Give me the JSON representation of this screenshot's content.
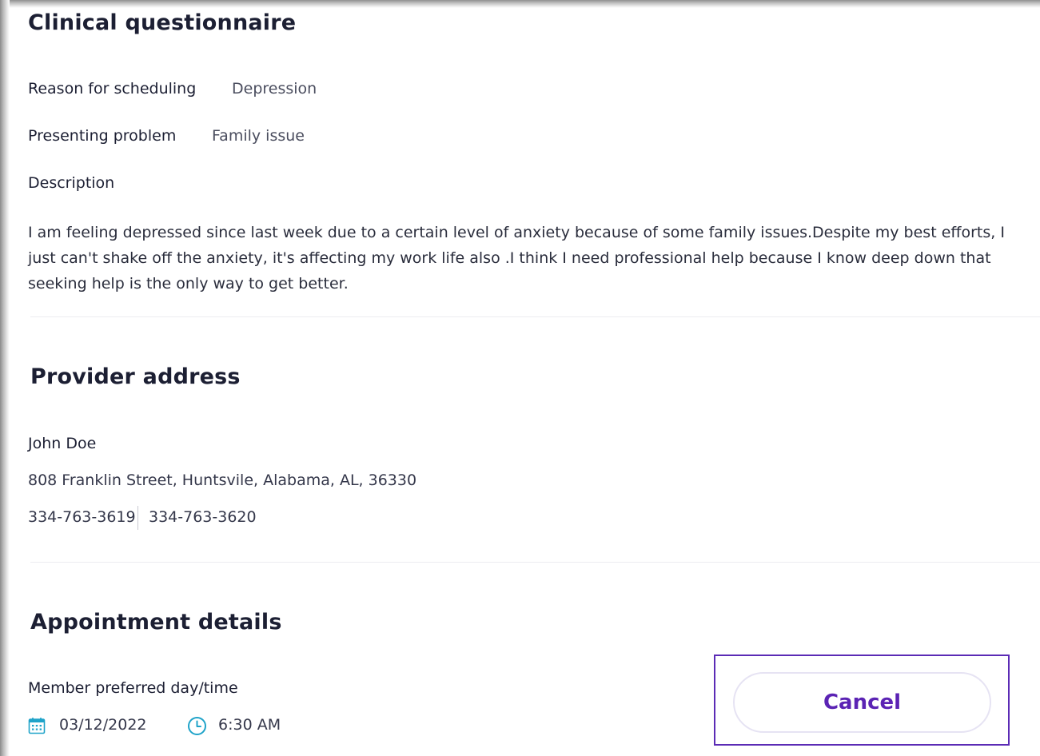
{
  "clinical": {
    "title": "Clinical questionnaire",
    "reason_label": "Reason for scheduling",
    "reason_value": "Depression",
    "problem_label": "Presenting problem",
    "problem_value": "Family issue",
    "description_label": "Description",
    "description_text": "I am feeling depressed since last week due to a certain level of anxiety because of some family issues.Despite my best efforts, I just can't shake off the anxiety, it's affecting my work life also .I think I need professional help because I know deep down that seeking help is the only way to get better."
  },
  "provider": {
    "title": "Provider address",
    "name": "John Doe",
    "address": "808 Franklin Street, Huntsvile, Alabama, AL, 36330",
    "phone_1": "334-763-3619",
    "phone_2": "334-763-3620"
  },
  "appointment": {
    "title": "Appointment details",
    "preferred_label": "Member preferred day/time",
    "date": "03/12/2022",
    "time": "6:30 AM",
    "date_icon": "calendar-icon",
    "time_icon": "clock-icon"
  },
  "actions": {
    "cancel_label": "Cancel"
  },
  "colors": {
    "accent": "#5b23b4",
    "icon_teal": "#1fa3c9",
    "focus_border": "#5b2bb5"
  }
}
